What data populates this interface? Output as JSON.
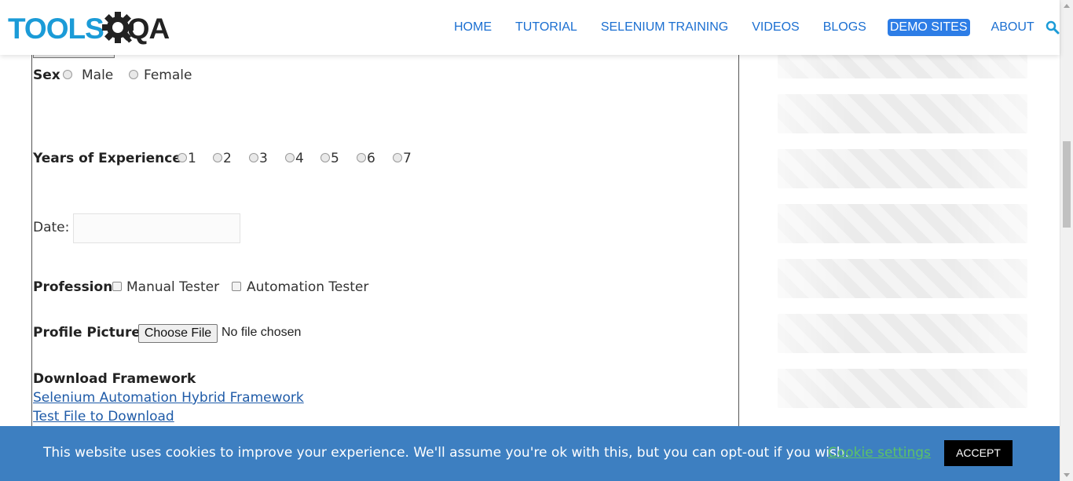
{
  "header": {
    "logo_part1": "TOOLS",
    "logo_part2": "QA",
    "nav": [
      {
        "label": "HOME"
      },
      {
        "label": "TUTORIAL"
      },
      {
        "label": "SELENIUM TRAINING"
      },
      {
        "label": "VIDEOS"
      },
      {
        "label": "BLOGS"
      },
      {
        "label": "DEMO SITES",
        "active": true
      },
      {
        "label": "ABOUT"
      }
    ],
    "search_icon": "search-icon"
  },
  "form": {
    "sex": {
      "label": "Sex",
      "options": [
        "Male",
        "Female"
      ]
    },
    "experience": {
      "label": "Years of Experience",
      "options": [
        "1",
        "2",
        "3",
        "4",
        "5",
        "6",
        "7"
      ]
    },
    "date": {
      "label": "Date:",
      "value": ""
    },
    "profession": {
      "label": "Profession",
      "options": [
        "Manual Tester",
        "Automation Tester"
      ]
    },
    "profile_picture": {
      "label": "Profile Picture",
      "button": "Choose File",
      "status": "No file chosen"
    },
    "download": {
      "label": "Download Framework",
      "links": [
        "Selenium Automation Hybrid Framework",
        "Test File to Download"
      ]
    }
  },
  "cookie_banner": {
    "message": "This website uses cookies to improve your experience. We'll assume you're ok with this, but you can opt-out if you wish.",
    "settings_label": "Cookie settings",
    "accept_label": "ACCEPT"
  },
  "colors": {
    "nav_link": "#1b6fd1",
    "nav_active_bg": "#2d7de6",
    "logo_blue": "#1b9bd7",
    "link": "#1f5ba8",
    "cookie_bg": "#3d7fc1",
    "cookie_settings": "#5cc267"
  }
}
